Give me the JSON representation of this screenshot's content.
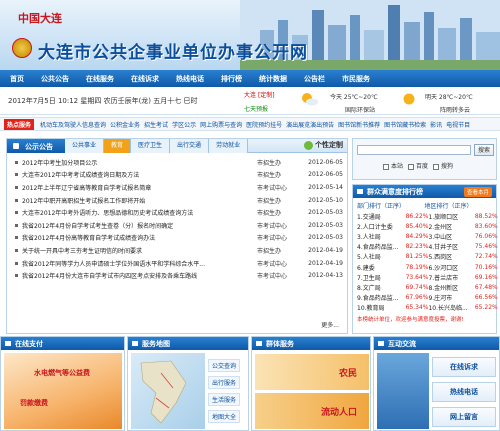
{
  "header": {
    "logo_text": "中国大连",
    "site_title": "大连市公共企事业单位办事公开网"
  },
  "nav": {
    "items": [
      "首页",
      "公共公告",
      "在线服务",
      "在线诉求",
      "热线电话",
      "排行榜",
      "统计数据",
      "公告栏",
      "市民服务"
    ]
  },
  "infobar": {
    "date": "2012年7月5日 10:12 星期四 农历壬辰年(龙) 五月十七 巳时",
    "city": "大连",
    "city_tag": "[定制]",
    "forecast_link": "七天预报",
    "today": "今天 25℃~20℃",
    "today_env": "国际环保站",
    "tomorrow": "明天 28℃~20℃",
    "tomorrow_env": "阵雨转多云"
  },
  "hotbar": {
    "tag": "热点服务",
    "links": [
      "机动车及驾驶人信息查询",
      "公积金业务",
      "招生考试",
      "学区公示",
      "网上购票与查询",
      "医院预约挂号",
      "演出展览演出预告",
      "图书馆新书推荐",
      "图书馆藏书检索",
      "影讯",
      "电视节目"
    ]
  },
  "main": {
    "title": "公示公告",
    "tabs": [
      "公共事业",
      "教育",
      "医疗卫生",
      "出行交通",
      "劳动就业"
    ],
    "active_tab": 1,
    "personal": "个性定制",
    "news": [
      {
        "title": "2012年中考生加分项目公示",
        "source": "市招生办",
        "date": "2012-06-05"
      },
      {
        "title": "大连市2012年中考考试成绩查询日期及方法",
        "source": "市招生办",
        "date": "2012-06-05"
      },
      {
        "title": "2012年上半年辽宁省高等教育自学考试报名简章",
        "source": "市考试中心",
        "date": "2012-05-14"
      },
      {
        "title": "2012年中职开高职招生考试报名工作即将开始",
        "source": "市招生办",
        "date": "2012-05-10"
      },
      {
        "title": "大连市2012年中考外语听力、思想品德和历史考试成绩查询方法",
        "source": "市招生办",
        "date": "2012-05-03"
      },
      {
        "title": "我省2012年4月份自学考试考生查卷（分）报名时间确定",
        "source": "市考试中心",
        "date": "2012-05-03"
      },
      {
        "title": "我省2012年4月份高等教育自学考试成绩查询办法",
        "source": "市考试中心",
        "date": "2012-05-03"
      },
      {
        "title": "关于统一开具中考三夯考生证明信的时间要求",
        "source": "市招生办",
        "date": "2012-04-19"
      },
      {
        "title": "我省2012年同等学力人员申请硕士学位外国语水平和学科综合水平...",
        "source": "市考试中心",
        "date": "2012-04-19"
      },
      {
        "title": "我省2012年4月份大连市自学考试市内四区考点安排及各乘车路线",
        "source": "市考试中心",
        "date": "2012-04-13"
      }
    ],
    "more": "更多..."
  },
  "search": {
    "button": "搜索",
    "options": [
      "本站",
      "百度",
      "搜狗"
    ]
  },
  "ranking": {
    "title": "群众满意度排行榜",
    "month_btn": "查看本月",
    "col_left": "部门排行（正序）",
    "col_right": "地区排行（正序）",
    "left": [
      {
        "name": "1.交通局",
        "value": "86.22%"
      },
      {
        "name": "2.人口计生委",
        "value": "85.40%"
      },
      {
        "name": "3.人社局",
        "value": "84.29%"
      },
      {
        "name": "4.食品药品监...",
        "value": "82.23%"
      },
      {
        "name": "5.人社局",
        "value": "81.25%"
      },
      {
        "name": "6.建委",
        "value": "78.19%"
      },
      {
        "name": "7.卫生局",
        "value": "73.64%"
      },
      {
        "name": "8.文广局",
        "value": "69.74%"
      },
      {
        "name": "9.食品药品监...",
        "value": "67.96%"
      },
      {
        "name": "10.教育局",
        "value": "65.34%"
      }
    ],
    "right": [
      {
        "name": "1.旅顺口区",
        "value": "88.52%"
      },
      {
        "name": "2.金州区",
        "value": "83.60%"
      },
      {
        "name": "3.中山区",
        "value": "76.06%"
      },
      {
        "name": "4.甘井子区",
        "value": "75.46%"
      },
      {
        "name": "5.西岗区",
        "value": "72.74%"
      },
      {
        "name": "6.沙河口区",
        "value": "70.16%"
      },
      {
        "name": "7.普兰店市",
        "value": "69.16%"
      },
      {
        "name": "8.金州新区",
        "value": "67.48%"
      },
      {
        "name": "9.庄河市",
        "value": "66.56%"
      },
      {
        "name": "10.长兴岛临...",
        "value": "65.22%"
      }
    ],
    "footer": "本榜统计单位，欢迎参与满意度投票，谢谢!"
  },
  "bottom": {
    "online_pay": {
      "title": "在线支付",
      "line1": "水电燃气等公益费",
      "line2": "罚款缴费"
    },
    "map": {
      "title": "服务地图",
      "items": [
        "公交查询",
        "出行服务",
        "生活服务",
        "地图大全"
      ]
    },
    "group": {
      "title": "群体服务",
      "items": [
        "农民",
        "流动人口"
      ]
    },
    "interact": {
      "title": "互动交流",
      "items": [
        "在线诉求",
        "热线电话",
        "网上留言"
      ]
    }
  },
  "colors": {
    "brand_blue": "#0f5aa8",
    "accent_red": "#e2231a",
    "accent_orange": "#f2a11b"
  }
}
